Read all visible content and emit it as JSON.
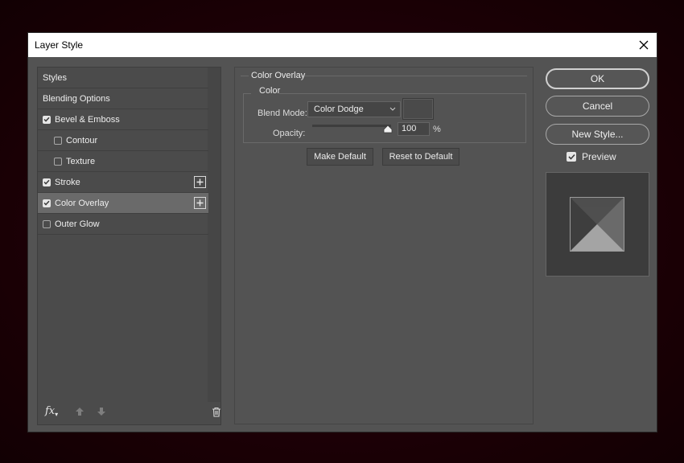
{
  "dialog": {
    "title": "Layer Style",
    "close_icon": "close-icon"
  },
  "styles_list": {
    "items": [
      {
        "label": "Styles",
        "has_checkbox": false,
        "checked": false,
        "selected": false,
        "has_plus": false
      },
      {
        "label": "Blending Options",
        "has_checkbox": false,
        "checked": false,
        "selected": false,
        "has_plus": false
      },
      {
        "label": "Bevel & Emboss",
        "has_checkbox": true,
        "checked": true,
        "selected": false,
        "has_plus": false
      },
      {
        "label": "Contour",
        "has_checkbox": true,
        "checked": false,
        "selected": false,
        "has_plus": false
      },
      {
        "label": "Texture",
        "has_checkbox": true,
        "checked": false,
        "selected": false,
        "has_plus": false
      },
      {
        "label": "Stroke",
        "has_checkbox": true,
        "checked": true,
        "selected": false,
        "has_plus": true
      },
      {
        "label": "Color Overlay",
        "has_checkbox": true,
        "checked": true,
        "selected": true,
        "has_plus": true
      },
      {
        "label": "Outer Glow",
        "has_checkbox": true,
        "checked": false,
        "selected": false,
        "has_plus": false
      }
    ],
    "footer": {
      "fx_label": "fx",
      "icons": [
        "fx-icon",
        "move-up-icon",
        "move-down-icon",
        "trash-icon"
      ]
    }
  },
  "color_overlay": {
    "group_title": "Color Overlay",
    "subgroup_title": "Color",
    "blend_mode_label": "Blend Mode:",
    "blend_mode_value": "Color Dodge",
    "color_swatch": "#4a4a4a",
    "opacity_label": "Opacity:",
    "opacity_value": "100",
    "opacity_unit": "%",
    "opacity_fraction": 1.0,
    "make_default_label": "Make Default",
    "reset_default_label": "Reset to Default"
  },
  "actions": {
    "ok_label": "OK",
    "cancel_label": "Cancel",
    "new_style_label": "New Style...",
    "preview_label": "Preview",
    "preview_checked": true
  },
  "colors": {
    "panel_bg": "#535353",
    "selected_row": "#6a6a6a",
    "backdrop": "#1e0006"
  }
}
